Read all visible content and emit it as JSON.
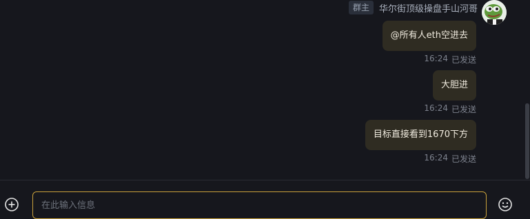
{
  "sender": {
    "role_badge": "群主",
    "name": "华尔街顶级操盘手山河哥"
  },
  "messages": [
    {
      "text": "@所有人eth空进去",
      "time": "16:24",
      "status": "已发送"
    },
    {
      "text": "大胆进",
      "time": "16:24",
      "status": "已发送"
    },
    {
      "text": "目标直接看到1670下方",
      "time": "16:24",
      "status": "已发送"
    }
  ],
  "input": {
    "placeholder": "在此输入信息"
  },
  "icons": {
    "attach": "plus-circle-icon",
    "emoji": "smiley-icon"
  },
  "colors": {
    "background": "#16171d",
    "bubble": "#2f2c22",
    "input_border": "#c9a13b",
    "muted_text": "#7d828d"
  }
}
